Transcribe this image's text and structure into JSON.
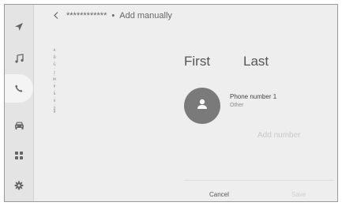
{
  "nav": {
    "items": [
      {
        "name": "navigation",
        "icon": "navigation-arrow-icon"
      },
      {
        "name": "music",
        "icon": "music-note-icon"
      },
      {
        "name": "phone",
        "icon": "phone-icon",
        "active": true
      },
      {
        "name": "vehicle",
        "icon": "car-icon"
      },
      {
        "name": "apps",
        "icon": "apps-grid-icon"
      },
      {
        "name": "settings",
        "icon": "gear-icon"
      }
    ]
  },
  "header": {
    "back_glyph": "<",
    "contact_masked": "************",
    "separator": "•",
    "title": "Add manually"
  },
  "index_letters": [
    "A",
    "·",
    "D",
    "·",
    "G",
    "·",
    "J",
    "·",
    "M",
    "·",
    "P",
    "·",
    "S",
    "·",
    "V",
    "·",
    "Z",
    "#"
  ],
  "contact": {
    "first_placeholder": "First",
    "last_placeholder": "Last",
    "phone_label": "Phone number 1",
    "phone_type": "Other",
    "add_number": "Add number"
  },
  "footer": {
    "cancel": "Cancel",
    "save": "Save"
  },
  "colors": {
    "accent_avatar": "#7a7a7a",
    "disabled_text": "#c8c8c8",
    "background": "#eeeeee"
  }
}
